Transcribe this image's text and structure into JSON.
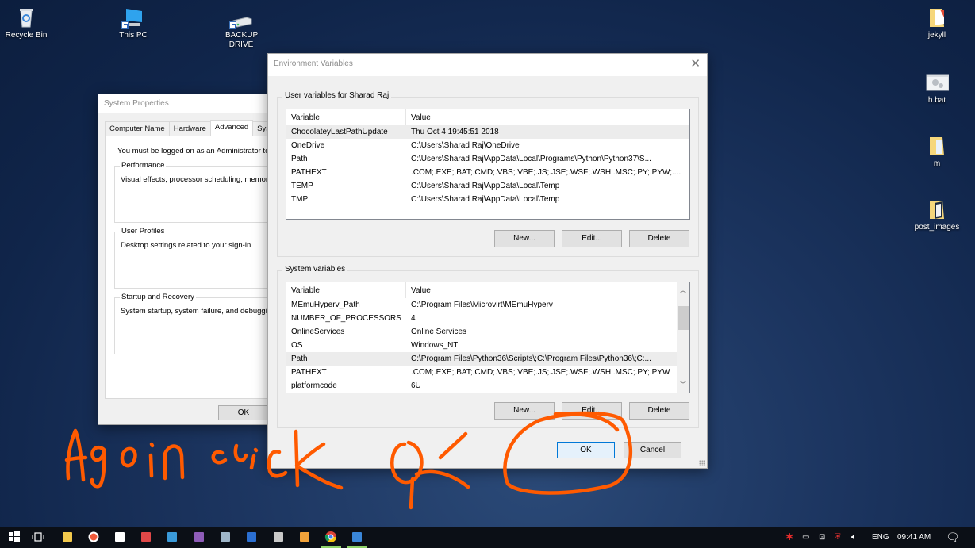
{
  "desktop": {
    "left_icons": [
      {
        "label": "Recycle Bin",
        "icon": "recycle-bin-icon"
      },
      {
        "label": "This PC",
        "icon": "computer-icon"
      },
      {
        "label": "BACKUP DRIVE",
        "icon": "drive-icon"
      }
    ],
    "right_icons": [
      {
        "label": "jekyll",
        "icon": "folder-icon"
      },
      {
        "label": "h.bat",
        "icon": "batch-file-icon"
      },
      {
        "label": "m",
        "icon": "folder-icon"
      },
      {
        "label": "post_images",
        "icon": "folder-icon"
      }
    ]
  },
  "system_properties": {
    "title": "System Properties",
    "tabs": [
      {
        "label": "Computer Name"
      },
      {
        "label": "Hardware"
      },
      {
        "label": "Advanced",
        "active": true
      },
      {
        "label": "Sys"
      }
    ],
    "admin_note": "You must be logged on as an Administrator to",
    "groups": [
      {
        "legend": "Performance",
        "desc": "Visual effects, processor scheduling, memor"
      },
      {
        "legend": "User Profiles",
        "desc": "Desktop settings related to your sign-in"
      },
      {
        "legend": "Startup and Recovery",
        "desc": "System startup, system failure, and debuggin"
      }
    ],
    "ok_label": "OK"
  },
  "env_vars": {
    "title": "Environment Variables",
    "close_icon": "close-icon",
    "user_section": {
      "legend": "User variables for Sharad Raj",
      "columns": [
        "Variable",
        "Value"
      ],
      "rows": [
        {
          "variable": "ChocolateyLastPathUpdate",
          "value": "Thu Oct  4 19:45:51 2018",
          "selected": true
        },
        {
          "variable": "OneDrive",
          "value": "C:\\Users\\Sharad Raj\\OneDrive"
        },
        {
          "variable": "Path",
          "value": "C:\\Users\\Sharad Raj\\AppData\\Local\\Programs\\Python\\Python37\\S..."
        },
        {
          "variable": "PATHEXT",
          "value": ".COM;.EXE;.BAT;.CMD;.VBS;.VBE;.JS;.JSE;.WSF;.WSH;.MSC;.PY;.PYW;...."
        },
        {
          "variable": "TEMP",
          "value": "C:\\Users\\Sharad Raj\\AppData\\Local\\Temp"
        },
        {
          "variable": "TMP",
          "value": "C:\\Users\\Sharad Raj\\AppData\\Local\\Temp"
        }
      ],
      "buttons": {
        "new": "New...",
        "edit": "Edit...",
        "delete": "Delete"
      }
    },
    "system_section": {
      "legend": "System variables",
      "columns": [
        "Variable",
        "Value"
      ],
      "rows": [
        {
          "variable": "MEmuHyperv_Path",
          "value": "C:\\Program Files\\Microvirt\\MEmuHyperv"
        },
        {
          "variable": "NUMBER_OF_PROCESSORS",
          "value": "4"
        },
        {
          "variable": "OnlineServices",
          "value": "Online Services"
        },
        {
          "variable": "OS",
          "value": "Windows_NT"
        },
        {
          "variable": "Path",
          "value": "C:\\Program Files\\Python36\\Scripts\\;C:\\Program Files\\Python36\\;C:...",
          "selected": true
        },
        {
          "variable": "PATHEXT",
          "value": ".COM;.EXE;.BAT;.CMD;.VBS;.VBE;.JS;.JSE;.WSF;.WSH;.MSC;.PY;.PYW"
        },
        {
          "variable": "platformcode",
          "value": "6U"
        }
      ],
      "buttons": {
        "new": "New...",
        "edit": "Edit...",
        "delete": "Delete"
      }
    },
    "ok_label": "OK",
    "cancel_label": "Cancel"
  },
  "annotation": {
    "text": "Again click OK",
    "color": "#ff5a00"
  },
  "taskbar": {
    "pinned": [
      "start-windows-icon",
      "task-view-icon",
      "file-explorer-icon",
      "recorder-icon",
      "sticky-notes-icon",
      "network-tool-icon",
      "control-panel-icon",
      "visual-studio-icon",
      "remote-desktop-icon",
      "powershell-icon",
      "command-prompt-icon",
      "git-icon",
      "chrome-icon",
      "system-properties-icon"
    ],
    "tray": {
      "language": "ENG",
      "time": "09:41 AM"
    }
  }
}
